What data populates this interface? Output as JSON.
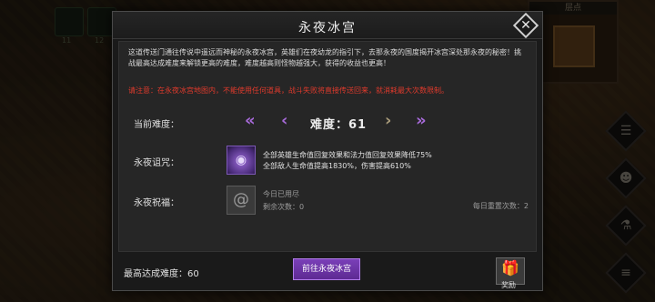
{
  "background": {
    "slot_values": [
      "11",
      "12"
    ],
    "minimap_title": "层点"
  },
  "modal": {
    "title": "永夜冰宫",
    "description": "这道传送门通往传说中遥远而神秘的永夜冰宫，英雄们在夜幼龙的指引下，去那永夜的国度揭开冰宫深处那永夜的秘密！挑战最高达成难度来解锁更高的难度，难度越高则怪物越强大，获得的收益也更高！",
    "warning": "请注意：在永夜冰宫地图内，不能使用任何道具，战斗失败将直接传送回来，就消耗最大次数限制。",
    "difficulty": {
      "label": "当前难度：",
      "value": "难度：61"
    },
    "curse": {
      "label": "永夜诅咒：",
      "lines": [
        "全部英雄生命值回复效果和法力值回复效果降低75%",
        "全部敌人生命值提高1830%，伤害提高610%"
      ]
    },
    "blessing": {
      "label": "永夜祝福：",
      "status": "今日已用尽",
      "remaining": "剩余次数：0",
      "daily_reset": "每日重置次数：2"
    },
    "footer": {
      "highest": "最高达成难度：60",
      "go_button": "前往永夜冰宫",
      "reward_label": "奖励"
    }
  },
  "icons": {
    "close": "close-icon",
    "curse": "curse-icon",
    "blessing": "vortex-icon",
    "reward": "gift-icon"
  },
  "colors": {
    "accent": "#7a3fb8",
    "warning": "#e03a2c",
    "arrow": "#a76ad9"
  }
}
